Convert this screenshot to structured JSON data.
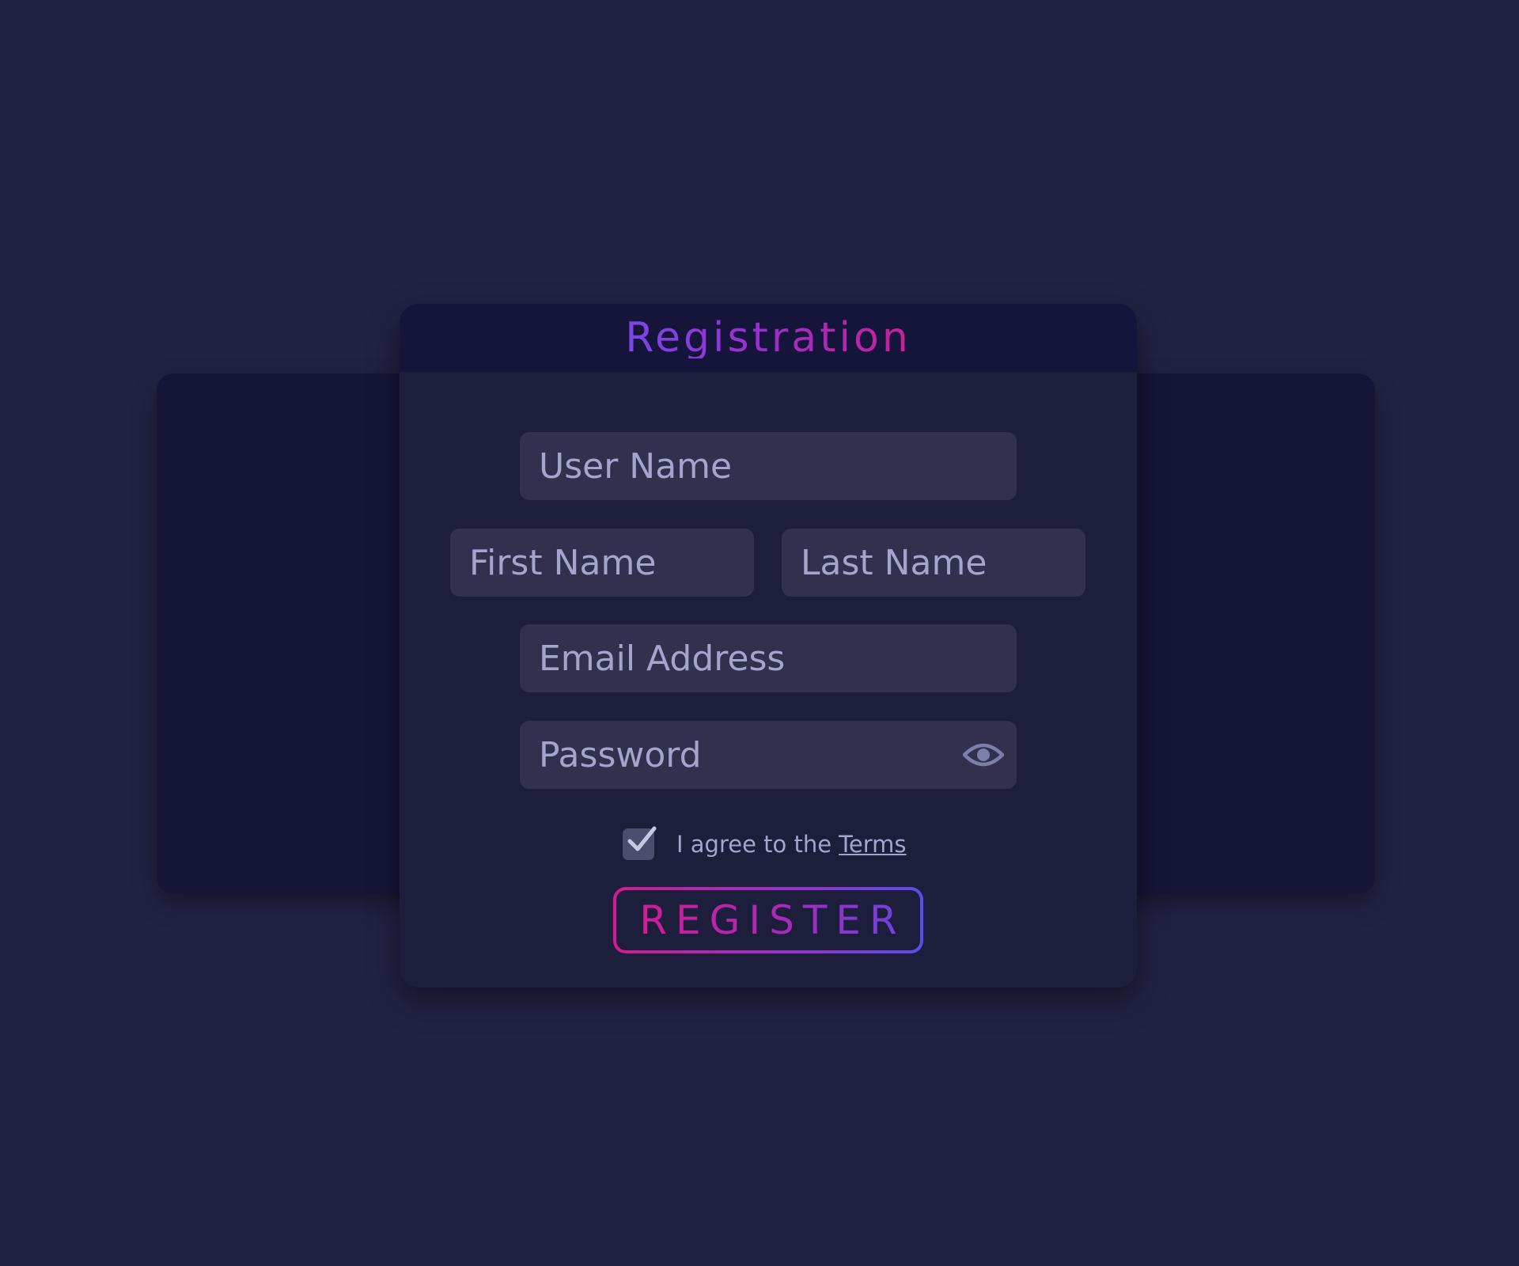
{
  "form": {
    "title": "Registration",
    "fields": {
      "username": {
        "placeholder": "User Name",
        "value": ""
      },
      "first_name": {
        "placeholder": "First Name",
        "value": ""
      },
      "last_name": {
        "placeholder": "Last Name",
        "value": ""
      },
      "email": {
        "placeholder": "Email Address",
        "value": ""
      },
      "password": {
        "placeholder": "Password",
        "value": "",
        "toggle_icon": "eye-icon"
      }
    },
    "agree": {
      "checked": true,
      "text": "I agree to the",
      "link_label": "Terms"
    },
    "submit_label": "REGISTER"
  },
  "colors": {
    "page_background": "#222244",
    "card_background": "#1d1d3c",
    "header_background": "#15143a",
    "field_background": "#31314f",
    "placeholder_text": "#a3a5cc",
    "accent_pink": "#d21c92",
    "accent_purple": "#7a46e8",
    "accent_blue": "#5a4ee8"
  }
}
